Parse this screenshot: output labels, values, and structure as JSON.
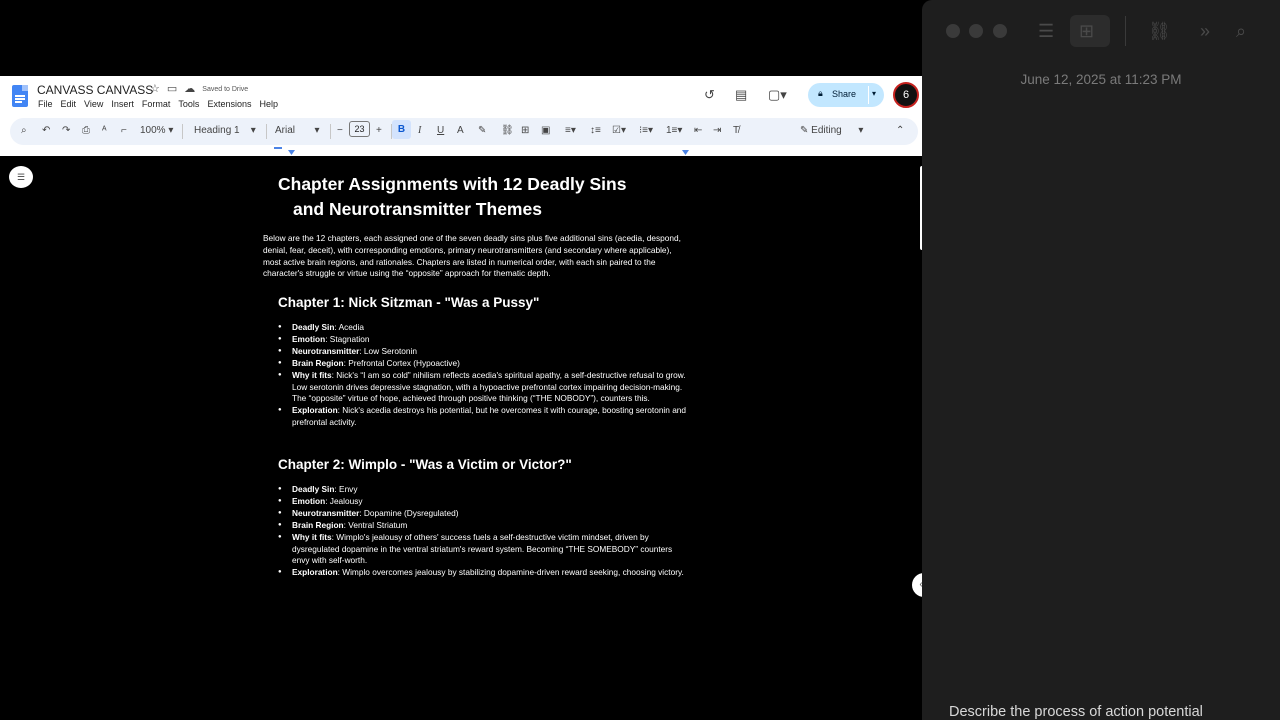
{
  "docs": {
    "title": "CANVASS CANVASS",
    "saved_status": "Saved to Drive",
    "menu": [
      "File",
      "Edit",
      "View",
      "Insert",
      "Format",
      "Tools",
      "Extensions",
      "Help"
    ],
    "share_label": "Share",
    "avatar_initial": "6",
    "icons": {
      "history": "history-icon",
      "comments": "comment-icon",
      "meet": "video-call-icon"
    }
  },
  "toolbar": {
    "zoom": "100%",
    "style": "Heading 1",
    "font": "Arial",
    "font_size": "23",
    "bold": "B",
    "italic": "I",
    "underline": "U",
    "text_color": "A",
    "mode": "Editing"
  },
  "document": {
    "heading_line1": "Chapter Assignments with 12 Deadly Sins",
    "heading_line2": "and Neurotransmitter Themes",
    "intro": "Below are the 12 chapters, each assigned one of the seven deadly sins plus five additional sins (acedia, despond, denial, fear, deceit), with corresponding emotions, primary neurotransmitters (and secondary where applicable), most active brain regions, and rationales. Chapters are listed in numerical order, with each sin paired to the character's struggle or virtue using the “opposite” approach for thematic depth.",
    "chapters": [
      {
        "title": "Chapter 1: Nick Sitzman - \"Was a Pussy\"",
        "items": [
          {
            "label": "Deadly Sin",
            "text": ": Acedia"
          },
          {
            "label": "Emotion",
            "text": ": Stagnation"
          },
          {
            "label": "Neurotransmitter",
            "text": ": Low Serotonin"
          },
          {
            "label": "Brain Region",
            "text": ": Prefrontal Cortex (Hypoactive)"
          },
          {
            "label": "Why it fits",
            "text": ": Nick's “I am so cold” nihilism reflects acedia's spiritual apathy, a self-destructive refusal to grow. Low serotonin drives depressive stagnation, with a hypoactive prefrontal cortex impairing decision-making. The “opposite” virtue of hope, achieved through positive thinking (“THE NOBODY”), counters this."
          },
          {
            "label": "Exploration",
            "text": ": Nick's acedia destroys his potential, but he overcomes it with courage, boosting serotonin and prefrontal activity."
          }
        ]
      },
      {
        "title": "Chapter 2: Wimplo - \"Was a Victim or Victor?\"",
        "items": [
          {
            "label": "Deadly Sin",
            "text": ": Envy"
          },
          {
            "label": "Emotion",
            "text": ": Jealousy"
          },
          {
            "label": "Neurotransmitter",
            "text": ": Dopamine (Dysregulated)"
          },
          {
            "label": "Brain Region",
            "text": ": Ventral Striatum"
          },
          {
            "label": "Why it fits",
            "text": ": Wimplo's jealousy of others' success fuels a self-destructive victim mindset, driven by dysregulated dopamine in the ventral striatum's reward system. Becoming “THE SOMEBODY” counters envy with self-worth."
          },
          {
            "label": "Exploration",
            "text": ": Wimplo overcomes jealousy by stabilizing dopamine-driven reward seeking, choosing victory."
          }
        ]
      }
    ]
  },
  "panel": {
    "date": "June 12, 2025 at 11:23 PM",
    "bottom_text": "Describe the process of action potential"
  }
}
